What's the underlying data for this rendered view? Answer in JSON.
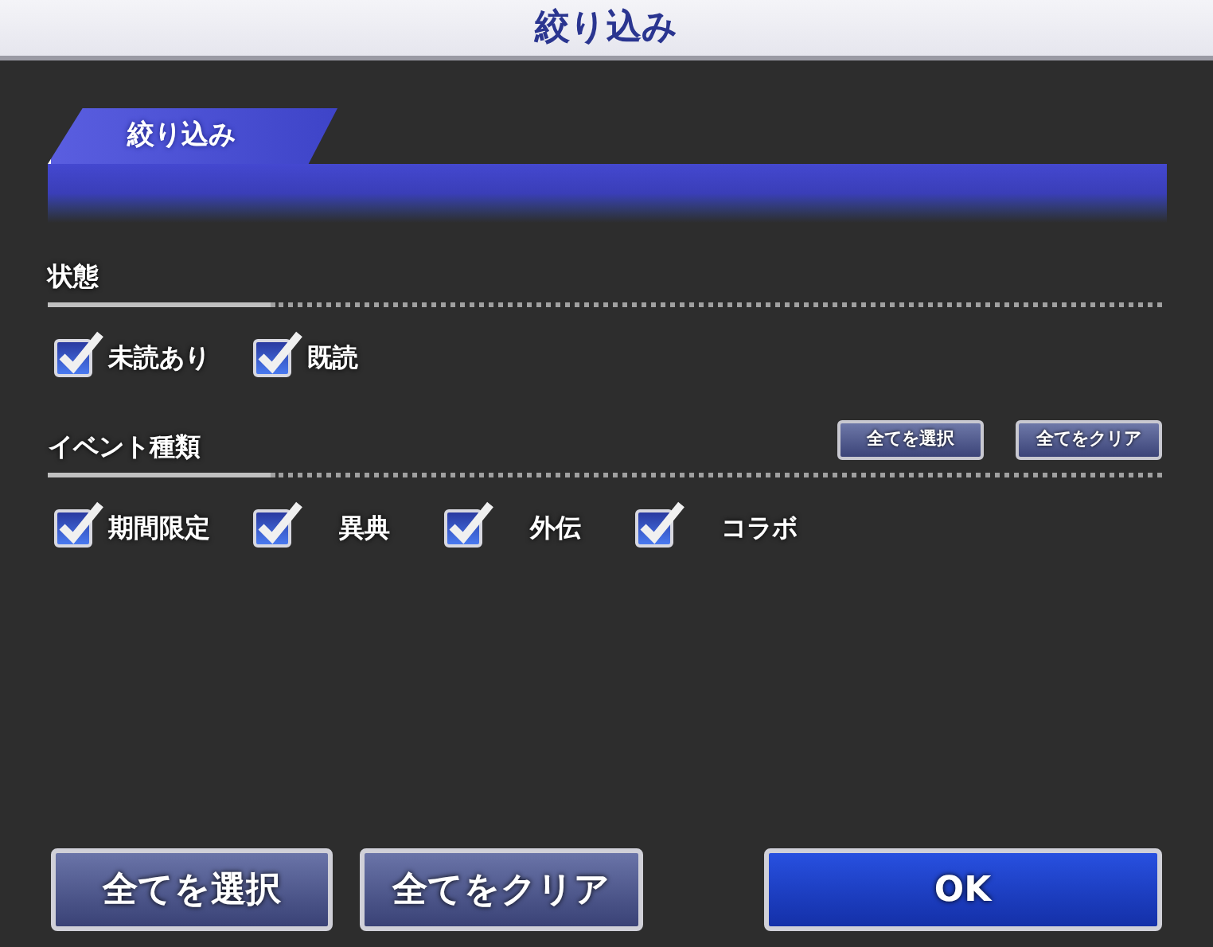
{
  "window": {
    "title": "絞り込み"
  },
  "tab": {
    "label": "絞り込み"
  },
  "sections": [
    {
      "heading": "状態",
      "options": [
        {
          "label": "未読あり",
          "checked": true
        },
        {
          "label": "既読",
          "checked": true
        }
      ]
    },
    {
      "heading": "イベント種類",
      "buttons": [
        "全てを選択",
        "全てをクリア"
      ],
      "options": [
        {
          "label": "期間限定",
          "checked": true
        },
        {
          "label": "異典",
          "checked": true
        },
        {
          "label": "外伝",
          "checked": true
        },
        {
          "label": "コラボ",
          "checked": true
        }
      ]
    }
  ],
  "footer_buttons": [
    {
      "label": "全てを選択",
      "kind": "secondary"
    },
    {
      "label": "全てをクリア",
      "kind": "secondary"
    },
    {
      "label": "OK",
      "kind": "primary"
    }
  ]
}
